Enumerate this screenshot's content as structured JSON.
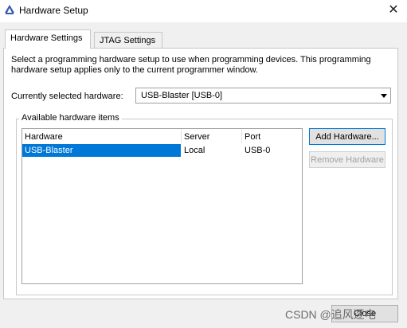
{
  "window": {
    "title": "Hardware Setup",
    "close_glyph": "✕"
  },
  "tabs": [
    {
      "label": "Hardware Settings",
      "active": true
    },
    {
      "label": "JTAG Settings",
      "active": false
    }
  ],
  "hardware_settings": {
    "description": "Select a programming hardware setup to use when programming devices. This programming hardware setup applies only to the current programmer window.",
    "currently_selected_label": "Currently selected hardware:",
    "currently_selected_value": "USB-Blaster [USB-0]",
    "available_group_label": "Available hardware items",
    "table": {
      "columns": [
        "Hardware",
        "Server",
        "Port"
      ],
      "rows": [
        {
          "hardware": "USB-Blaster",
          "server": "Local",
          "port": "USB-0",
          "selected": true
        }
      ]
    },
    "buttons": {
      "add": "Add Hardware...",
      "remove": "Remove Hardware"
    }
  },
  "footer": {
    "close": "Close"
  },
  "watermark": "CSDN @追风逐电",
  "colors": {
    "selection": "#0078d7",
    "background": "#f0f0f0"
  }
}
